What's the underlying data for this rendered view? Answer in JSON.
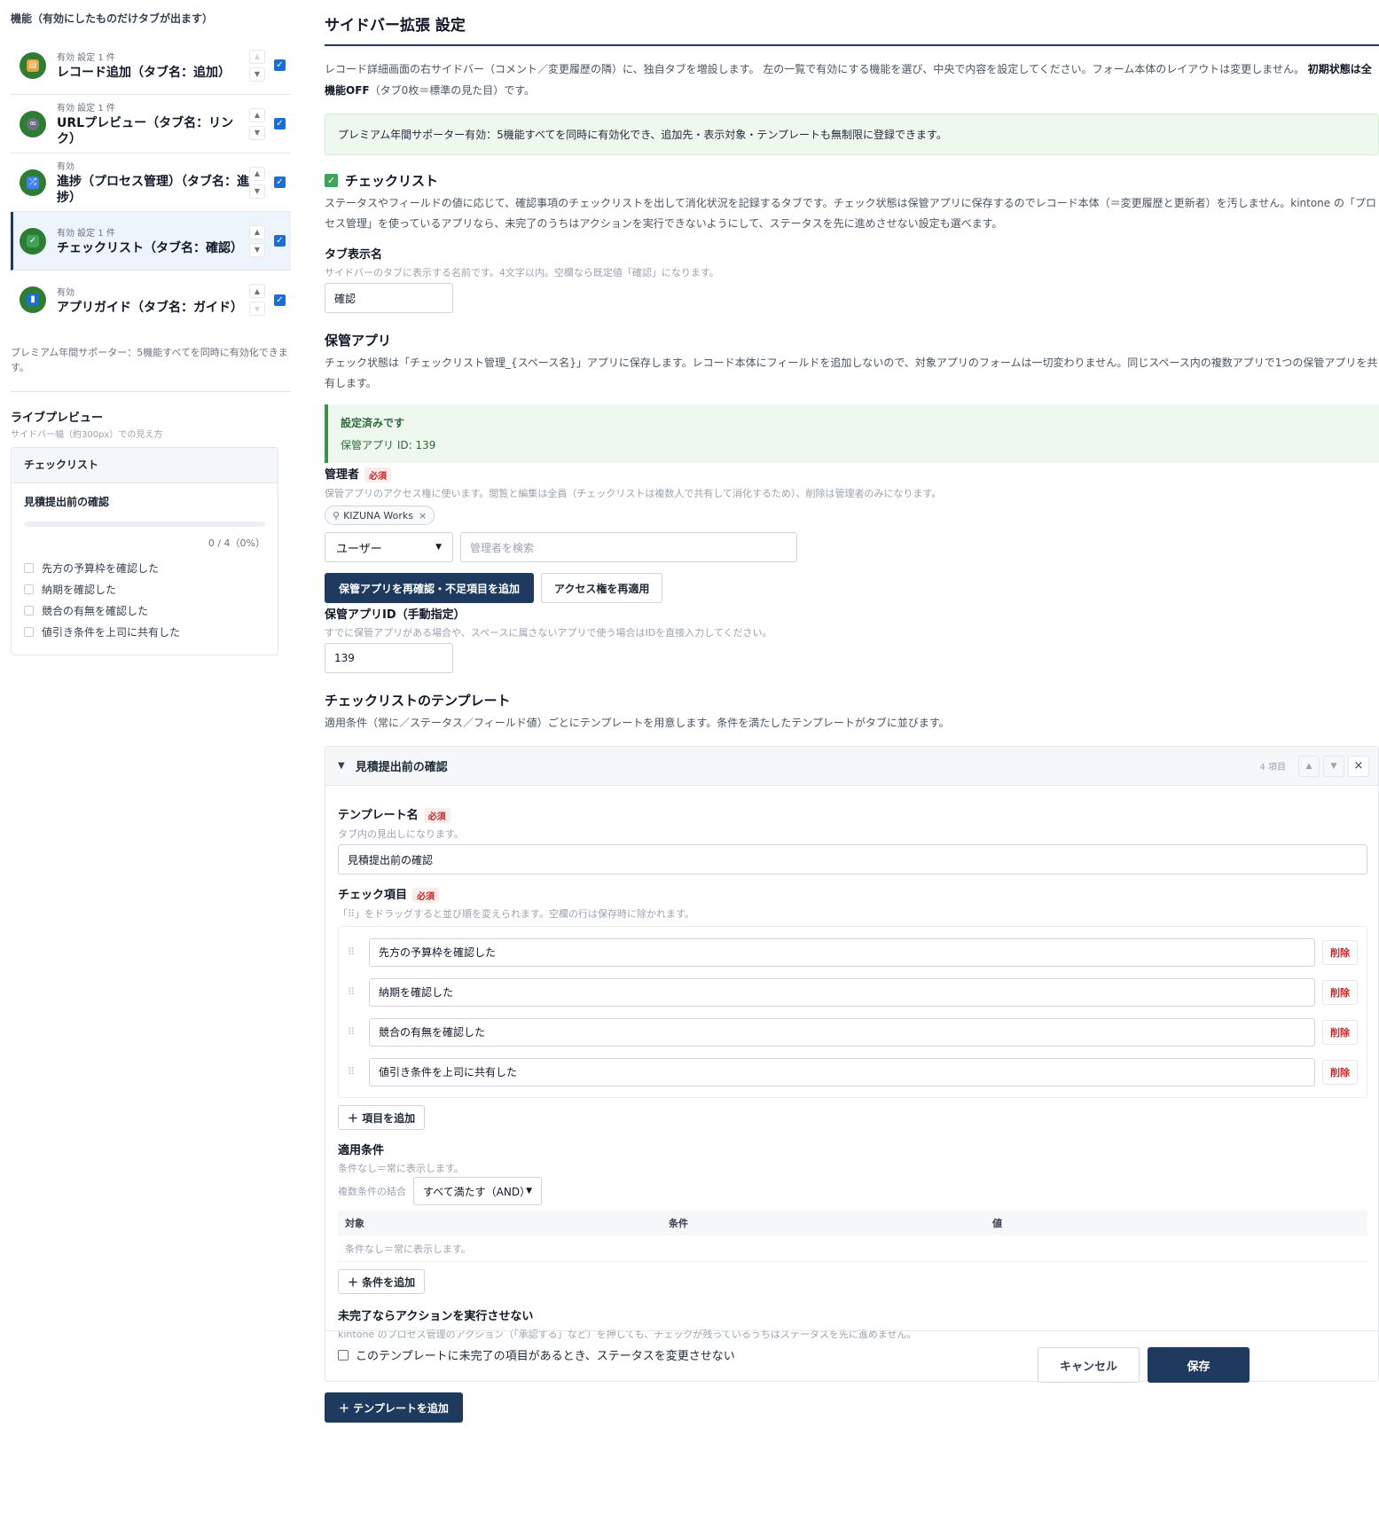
{
  "sidebar": {
    "heading": "機能（有効にしたものだけタブが出ます）",
    "features": [
      {
        "meta": "有効  設定 1 件",
        "name": "レコード追加（タブ名：追加）",
        "icon": "document-icon",
        "color": "#e8a03a"
      },
      {
        "meta": "有効  設定 1 件",
        "name": "URLプレビュー（タブ名：リンク）",
        "icon": "link-icon",
        "color": "#6b7280"
      },
      {
        "meta": "有効",
        "name": "進捗（プロセス管理）（タブ名：進捗）",
        "icon": "shuffle-icon",
        "color": "#3b82f6"
      },
      {
        "meta": "有効  設定 1 件",
        "name": "チェックリスト（タブ名：確認）",
        "icon": "check-icon",
        "color": "#3fa35a"
      },
      {
        "meta": "有効",
        "name": "アプリガイド（タブ名：ガイド）",
        "icon": "book-icon",
        "color": "#1a6fd6"
      }
    ],
    "premium_note": "プレミアム年間サポーター：5機能すべてを同時に有効化できます。",
    "live_preview": {
      "title": "ライブプレビュー",
      "subtitle": "サイドバー幅（約300px）での見え方",
      "tab": "チェックリスト",
      "template_title": "見積提出前の確認",
      "count": "0 / 4（0%）",
      "progress": 0,
      "items": [
        "先方の予算枠を確認した",
        "納期を確認した",
        "競合の有無を確認した",
        "値引き条件を上司に共有した"
      ]
    }
  },
  "main": {
    "title": "サイドバー拡張 設定",
    "intro_text": "レコード詳細画面の右サイドバー（コメント／変更履歴の隣）に、独自タブを増設します。 左の一覧で有効にする機能を選び、中央で内容を設定してください。フォーム本体のレイアウトは変更しません。",
    "intro_bold": "初期状態は全機能OFF",
    "intro_tail": "（タブ0枚＝標準の見た目）です。",
    "premium_banner": "プレミアム年間サポーター有効：5機能すべてを同時に有効化でき、追加先・表示対象・テンプレートも無制限に登録できます。",
    "section_title": "チェックリスト",
    "section_desc": "ステータスやフィールドの値に応じて、確認事項のチェックリストを出して消化状況を記録するタブです。チェック状態は保管アプリに保存するのでレコード本体（＝変更履歴と更新者）を汚しません。kintone の「プロセス管理」を使っているアプリなら、未完了のうちはアクションを実行できないようにして、ステータスを先に進めさせない設定も選べます。",
    "tab_name_label": "タブ表示名",
    "tab_name_hint": "サイドバーのタブに表示する名前です。4文字以内。空欄なら既定値「確認」になります。",
    "tab_name_value": "確認",
    "storage_title": "保管アプリ",
    "storage_desc": "チェック状態は「チェックリスト管理_{スペース名}」アプリに保存します。レコード本体にフィールドを追加しないので、対象アプリのフォームは一切変わりません。同じスペース内の複数アプリで1つの保管アプリを共有します。",
    "ok_title": "設定済みです",
    "ok_sub": "保管アプリ ID: 139",
    "admin_label": "管理者",
    "required": "必須",
    "admin_hint": "保管アプリのアクセス権に使います。閲覧と編集は全員（チェックリストは複数人で共有して消化するため）、削除は管理者のみになります。",
    "admin_chip": "KIZUNA Works",
    "admin_type": "ユーザー",
    "admin_search_placeholder": "管理者を検索",
    "btn_recheck": "保管アプリを再確認・不足項目を追加",
    "btn_reapply": "アクセス権を再適用",
    "manual_id_label": "保管アプリID（手動指定）",
    "manual_id_hint": "すでに保管アプリがある場合や、スペースに属さないアプリで使う場合はIDを直接入力してください。",
    "manual_id_value": "139",
    "templates_title": "チェックリストのテンプレート",
    "templates_desc": "適用条件（常に／ステータス／フィールド値）ごとにテンプレートを用意します。条件を満たしたテンプレートがタブに並びます。",
    "template": {
      "name": "見積提出前の確認",
      "count": "4 項目",
      "name_label": "テンプレート名",
      "name_hint": "タブ内の見出しになります。",
      "items_label": "チェック項目",
      "items_hint": "「⠿」をドラッグすると並び順を変えられます。空欄の行は保存時に除かれます。",
      "items": [
        "先方の予算枠を確認した",
        "納期を確認した",
        "競合の有無を確認した",
        "値引き条件を上司に共有した"
      ],
      "delete_label": "削除",
      "add_item": "＋ 項目を追加",
      "cond_label": "適用条件",
      "cond_hint": "条件なし＝常に表示します。",
      "combine_label": "複数条件の結合",
      "combine_value": "すべて満たす（AND）",
      "cond_cols": [
        "対象",
        "条件",
        "値"
      ],
      "cond_empty": "条件なし＝常に表示します。",
      "add_cond": "＋ 条件を追加",
      "block_label": "未完了ならアクションを実行させない",
      "block_hint": "kintone のプロセス管理のアクション（「承認する」など）を押しても、チェックが残っているうちはステータスを先に進めません。",
      "block_checkbox": "このテンプレートに未完了の項目があるとき、ステータスを変更させない"
    },
    "add_template": "＋ テンプレートを追加",
    "cancel": "キャンセル",
    "save": "保存"
  }
}
